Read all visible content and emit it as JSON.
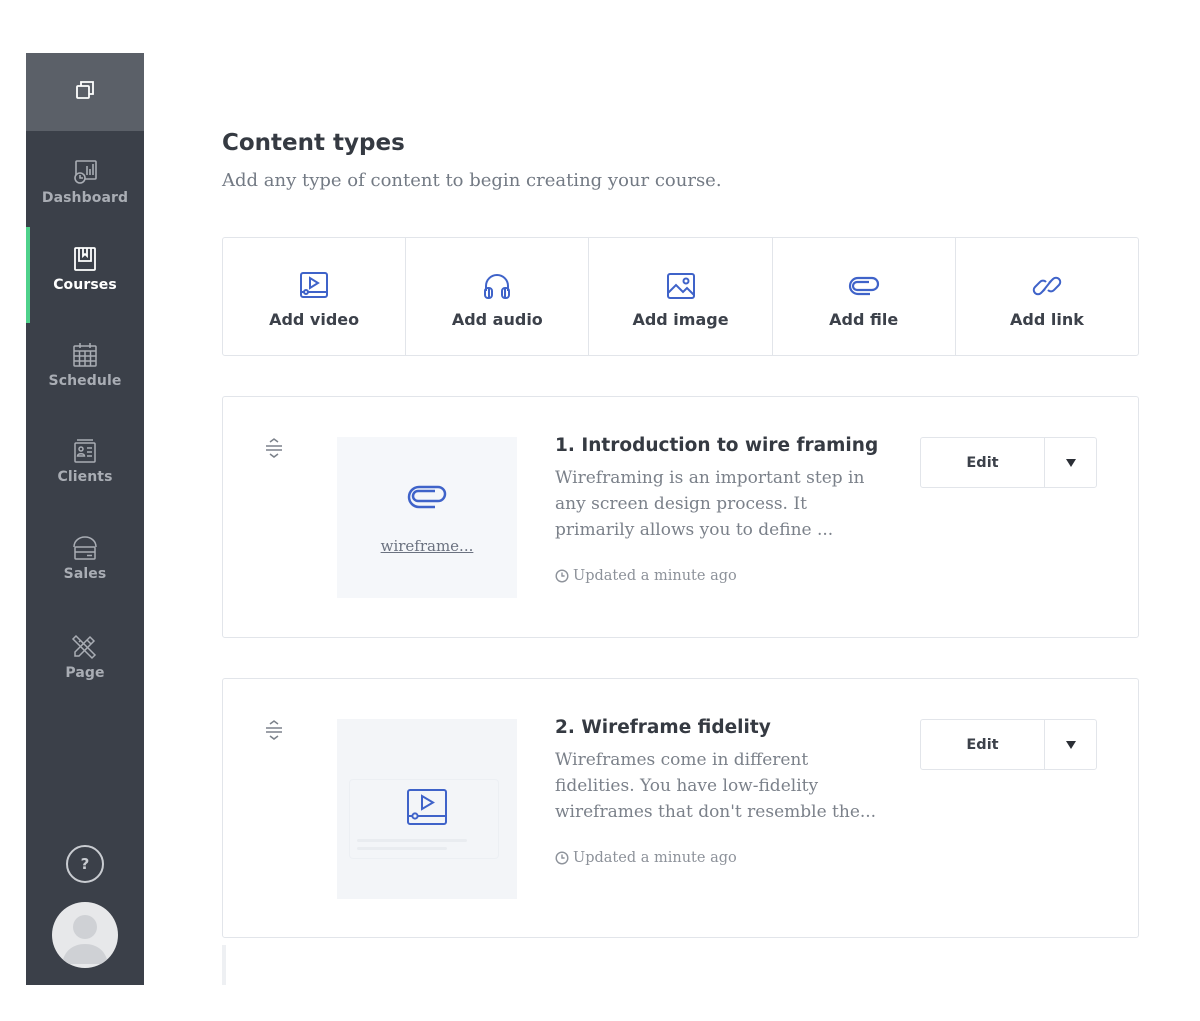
{
  "sidebar": {
    "top_icon": "copy-icon",
    "items": [
      {
        "label": "Dashboard",
        "icon": "dashboard-icon",
        "active": false
      },
      {
        "label": "Courses",
        "icon": "courses-icon",
        "active": true
      },
      {
        "label": "Schedule",
        "icon": "calendar-icon",
        "active": false
      },
      {
        "label": "Clients",
        "icon": "clients-icon",
        "active": false
      },
      {
        "label": "Sales",
        "icon": "sales-icon",
        "active": false
      },
      {
        "label": "Page",
        "icon": "page-icon",
        "active": false
      }
    ],
    "help_label": "?",
    "active_color": "#4fd18b",
    "bg_color": "#3b4049"
  },
  "main": {
    "title": "Content types",
    "subtitle": "Add any type of content to begin creating your course.",
    "content_types": [
      {
        "label": "Add video",
        "icon": "video-icon"
      },
      {
        "label": "Add audio",
        "icon": "headphones-icon"
      },
      {
        "label": "Add image",
        "icon": "image-icon"
      },
      {
        "label": "Add file",
        "icon": "paperclip-icon"
      },
      {
        "label": "Add link",
        "icon": "link-icon"
      }
    ],
    "accent_color": "#3f63c9",
    "lessons": [
      {
        "title": "1. Introduction to wire framing",
        "description": "Wireframing is an important step in any screen design process. It primarily allows you to define ...",
        "updated": "Updated a minute ago",
        "attachment_name": "wireframe...",
        "attachment_icon": "paperclip-icon",
        "edit_label": "Edit"
      },
      {
        "title": "2. Wireframe fidelity",
        "description": "Wireframes come in different fidelities. You have low-fidelity wireframes that don't resemble the...",
        "updated": "Updated a minute ago",
        "attachment_icon": "video-icon",
        "edit_label": "Edit"
      }
    ]
  }
}
